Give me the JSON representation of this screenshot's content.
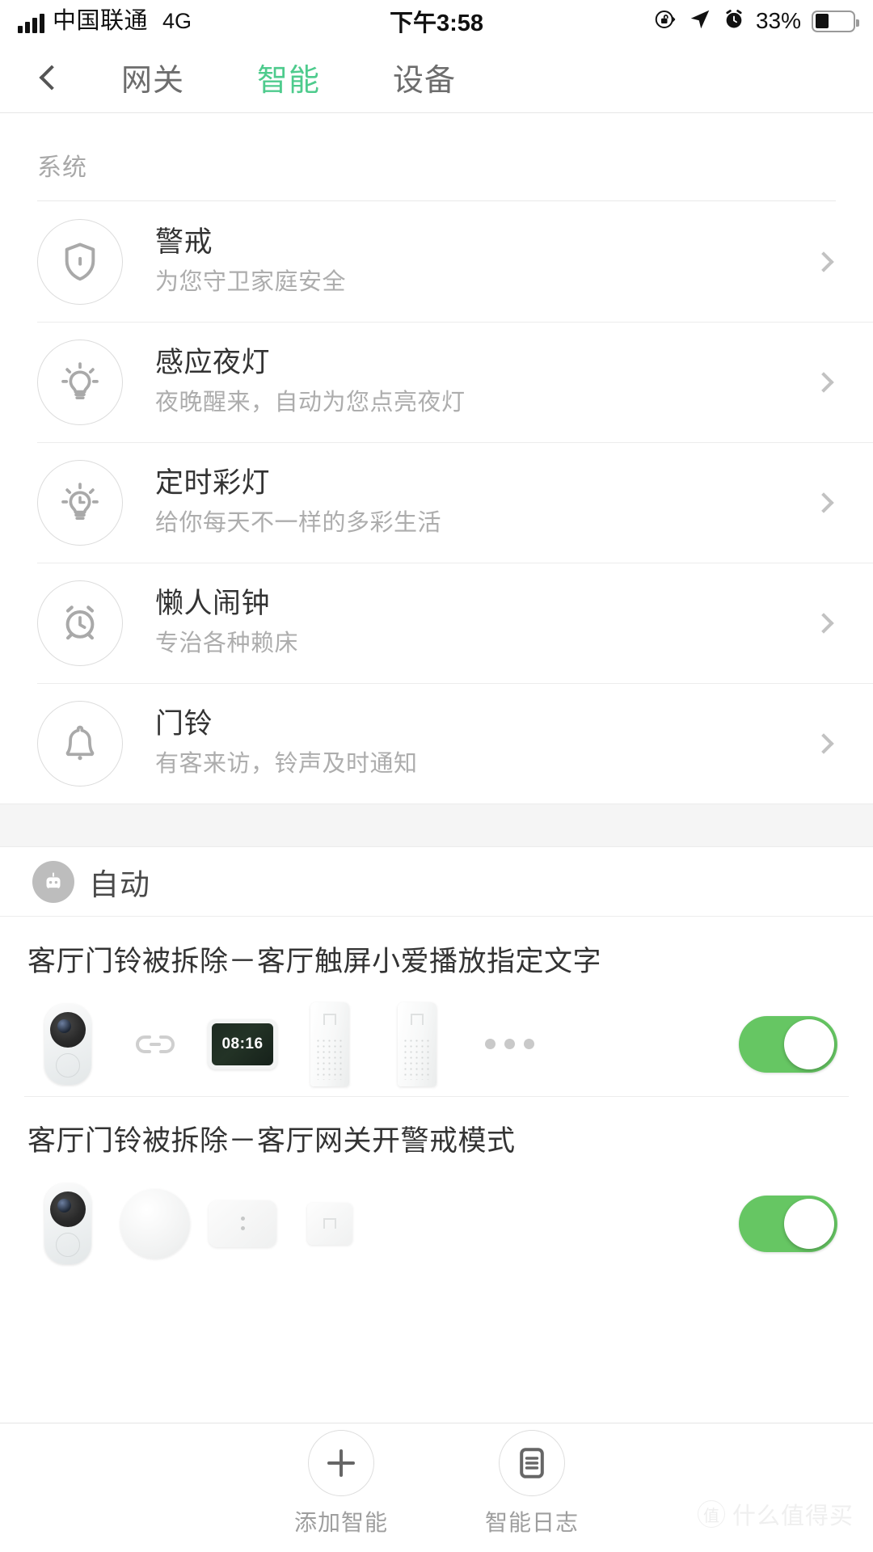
{
  "status_bar": {
    "carrier": "中国联通",
    "network": "4G",
    "time": "下午3:58",
    "battery_percent": "33%",
    "icons": [
      "signal-bars-icon",
      "rotation-lock-icon",
      "location-arrow-icon",
      "alarm-clock-icon",
      "battery-icon"
    ]
  },
  "nav": {
    "back_icon": "chevron-left-icon",
    "tabs": [
      {
        "label": "网关",
        "active": false
      },
      {
        "label": "智能",
        "active": true
      },
      {
        "label": "设备",
        "active": false
      }
    ]
  },
  "system_section": {
    "header": "系统",
    "items": [
      {
        "title": "警戒",
        "subtitle": "为您守卫家庭安全",
        "icon": "shield-icon"
      },
      {
        "title": "感应夜灯",
        "subtitle": "夜晚醒来，自动为您点亮夜灯",
        "icon": "lightbulb-icon"
      },
      {
        "title": "定时彩灯",
        "subtitle": "给你每天不一样的多彩生活",
        "icon": "lightbulb-clock-icon"
      },
      {
        "title": "懒人闹钟",
        "subtitle": "专治各种赖床",
        "icon": "alarm-clock-icon"
      },
      {
        "title": "门铃",
        "subtitle": "有客来访，铃声及时通知",
        "icon": "bell-icon"
      }
    ]
  },
  "auto_section": {
    "header": "自动",
    "header_icon": "robot-icon",
    "items": [
      {
        "name": "客厅门铃被拆除－客厅触屏小爱播放指定文字",
        "devices": [
          "doorbell-camera",
          "link",
          "smart-display",
          "mi-speaker",
          "mi-speaker"
        ],
        "display_time": "08:16",
        "more_icon": "ellipsis-icon",
        "enabled": true
      },
      {
        "name": "客厅门铃被拆除－客厅网关开警戒模式",
        "devices": [
          "doorbell-camera",
          "gateway",
          "switch-panel",
          "mi-plug"
        ],
        "enabled": true
      }
    ]
  },
  "bottom_bar": {
    "actions": [
      {
        "label": "添加智能",
        "icon": "plus-icon"
      },
      {
        "label": "智能日志",
        "icon": "document-icon"
      }
    ]
  },
  "watermark": {
    "mark": "值",
    "text": "什么值得买"
  },
  "colors": {
    "accent": "#4ecb8d",
    "toggle_on": "#66c663",
    "text_primary": "#333333",
    "text_secondary": "#adadad"
  }
}
